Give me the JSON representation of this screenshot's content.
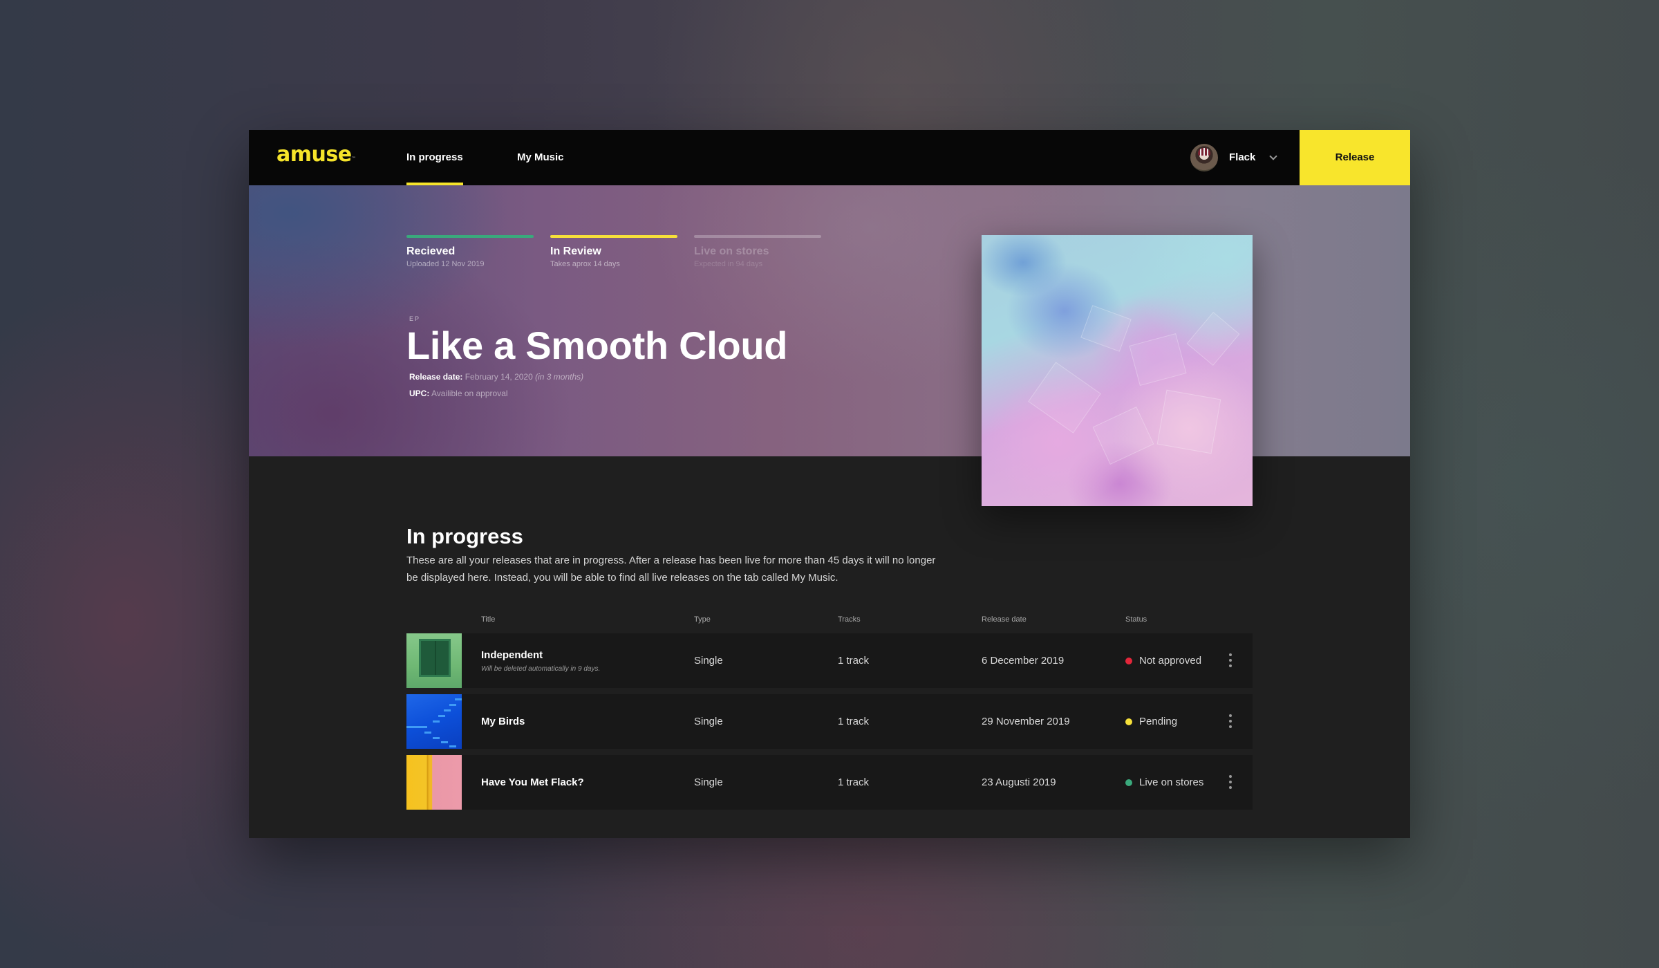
{
  "header": {
    "logo": "amuse",
    "logo_mark": "™",
    "tabs": [
      {
        "label": "In progress",
        "active": true
      },
      {
        "label": "My Music",
        "active": false
      }
    ],
    "user": {
      "name": "Flack"
    },
    "release_button": "Release",
    "colors": {
      "accent": "#f8e52c",
      "header_bg": "#070707"
    }
  },
  "hero": {
    "steps": [
      {
        "label": "Recieved",
        "sub": "Uploaded 12 Nov 2019",
        "color": "#3aa97c"
      },
      {
        "label": "In Review",
        "sub": "Takes aprox 14 days",
        "color": "#f6e03a"
      },
      {
        "label": "Live on stores",
        "sub": "Expected in 94 days",
        "color": "rgba(255,255,255,0.25)"
      }
    ],
    "type": "EP",
    "title": "Like a Smooth Cloud",
    "release_date_label": "Release date:",
    "release_date_value": "February 14, 2020",
    "release_date_relative": "(in 3 months)",
    "upc_label": "UPC:",
    "upc_value": "Availible on approval"
  },
  "main": {
    "title": "In progress",
    "description": "These are all your releases that are in progress. After a release has been live for more than 45 days it will no longer be displayed here. Instead, you will be able to find all live releases on the tab called My Music.",
    "table": {
      "columns": [
        "Title",
        "Type",
        "Tracks",
        "Release date",
        "Status"
      ],
      "rows": [
        {
          "title": "Independent",
          "note": "Will be deleted automatically in 9 days.",
          "type": "Single",
          "tracks": "1 track",
          "release_date": "6 December 2019",
          "status": "Not approved",
          "status_color": "#e3263a"
        },
        {
          "title": "My Birds",
          "note": "",
          "type": "Single",
          "tracks": "1 track",
          "release_date": "29 November 2019",
          "status": "Pending",
          "status_color": "#f6e03a"
        },
        {
          "title": "Have You Met Flack?",
          "note": "",
          "type": "Single",
          "tracks": "1 track",
          "release_date": "23 Augusti 2019",
          "status": "Live on stores",
          "status_color": "#3aa97c"
        }
      ]
    }
  }
}
